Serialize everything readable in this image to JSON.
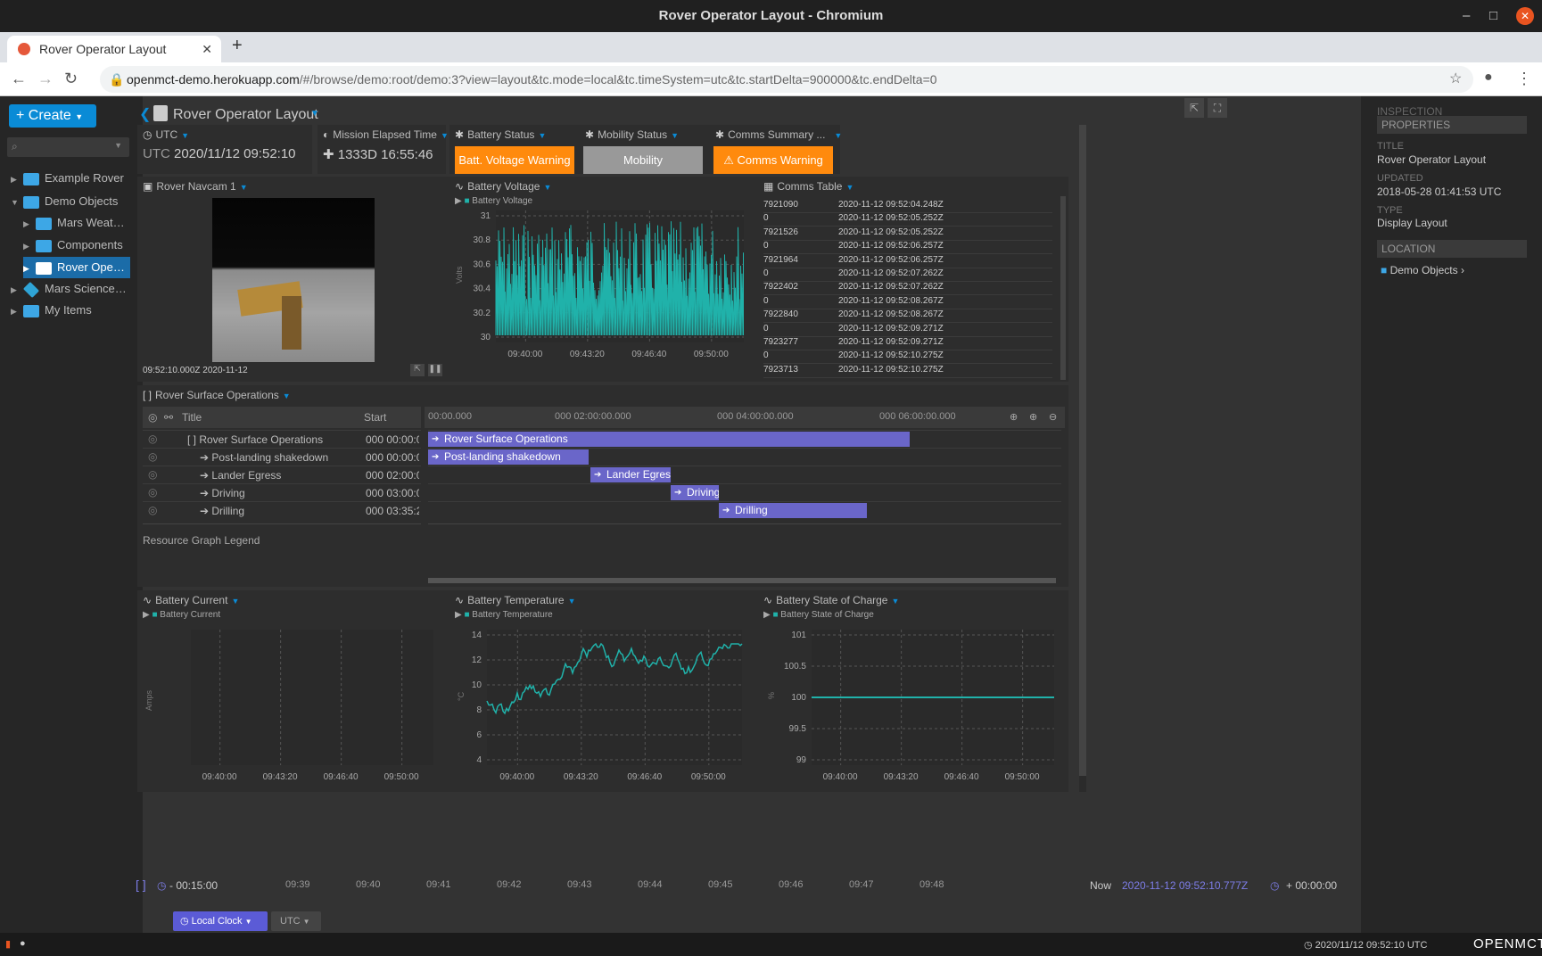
{
  "window": {
    "title": "Rover Operator Layout - Chromium"
  },
  "browser": {
    "tab_title": "Rover Operator Layout",
    "url_host": "openmct-demo.herokuapp.com",
    "url_path": "/#/browse/demo:root/demo:3?view=layout&tc.mode=local&tc.timeSystem=utc&tc.startDelta=900000&tc.endDelta=0"
  },
  "tree": {
    "create_label": "Create",
    "items": [
      "Example Rover",
      "Demo Objects",
      "Mars Weat…",
      "Components",
      "Rover Ope…",
      "Mars Science…",
      "My Items"
    ]
  },
  "header": {
    "title": "Rover Operator Layout"
  },
  "clock": {
    "title": "UTC",
    "prefix": "UTC",
    "value": "2020/11/12 09:52:10"
  },
  "met": {
    "title": "Mission Elapsed Time",
    "value": "1333D 16:55:46"
  },
  "battery_status": {
    "title": "Battery Status",
    "label": "Batt. Voltage Warning"
  },
  "mobility_status": {
    "title": "Mobility Status",
    "label": "Mobility"
  },
  "comms_summary": {
    "title": "Comms Summary ...",
    "label": "Comms Warning"
  },
  "navcam": {
    "title": "Rover Navcam 1",
    "timestamp": "09:52:10.000Z 2020-11-12"
  },
  "battery_voltage": {
    "title": "Battery Voltage",
    "legend": "Battery Voltage",
    "ylabel": "Volts",
    "yticks": [
      "31",
      "30.8",
      "30.6",
      "30.4",
      "30.2",
      "30"
    ],
    "xticks": [
      "09:40:00",
      "09:43:20",
      "09:46:40",
      "09:50:00"
    ]
  },
  "comms_table": {
    "title": "Comms Table",
    "rows": [
      [
        "7921090",
        "2020-11-12 09:52:04.248Z"
      ],
      [
        "0",
        "2020-11-12 09:52:05.252Z"
      ],
      [
        "7921526",
        "2020-11-12 09:52:05.252Z"
      ],
      [
        "0",
        "2020-11-12 09:52:06.257Z"
      ],
      [
        "7921964",
        "2020-11-12 09:52:06.257Z"
      ],
      [
        "0",
        "2020-11-12 09:52:07.262Z"
      ],
      [
        "7922402",
        "2020-11-12 09:52:07.262Z"
      ],
      [
        "0",
        "2020-11-12 09:52:08.267Z"
      ],
      [
        "7922840",
        "2020-11-12 09:52:08.267Z"
      ],
      [
        "0",
        "2020-11-12 09:52:09.271Z"
      ],
      [
        "7923277",
        "2020-11-12 09:52:09.271Z"
      ],
      [
        "0",
        "2020-11-12 09:52:10.275Z"
      ],
      [
        "7923713",
        "2020-11-12 09:52:10.275Z"
      ]
    ]
  },
  "timeline": {
    "title": "Rover Surface Operations",
    "col_title": "Title",
    "col_start": "Start",
    "ticks": [
      "00:00.000",
      "000 02:00:00.000",
      "000 04:00:00.000",
      "000 06:00:00.000"
    ],
    "rows": [
      {
        "title": "Rover Surface Operations",
        "start": "000 00:00:0"
      },
      {
        "title": "Post-landing shakedown",
        "start": "000 00:00:0"
      },
      {
        "title": "Lander Egress",
        "start": "000 02:00:0"
      },
      {
        "title": "Driving",
        "start": "000 03:00:0"
      },
      {
        "title": "Drilling",
        "start": "000 03:35:2"
      }
    ],
    "legend_label": "Resource Graph Legend"
  },
  "battery_current": {
    "title": "Battery Current",
    "legend": "Battery Current",
    "ylabel": "Amps",
    "xticks": [
      "09:40:00",
      "09:43:20",
      "09:46:40",
      "09:50:00"
    ]
  },
  "battery_temperature": {
    "title": "Battery Temperature",
    "legend": "Battery Temperature",
    "ylabel": "°C",
    "yticks": [
      "14",
      "12",
      "10",
      "8",
      "6",
      "4"
    ],
    "xticks": [
      "09:40:00",
      "09:43:20",
      "09:46:40",
      "09:50:00"
    ]
  },
  "battery_soc": {
    "title": "Battery State of Charge",
    "legend": "Battery State of Charge",
    "ylabel": "%",
    "yticks": [
      "101",
      "100.5",
      "100",
      "99.5",
      "99"
    ],
    "xticks": [
      "09:40:00",
      "09:43:20",
      "09:46:40",
      "09:50:00"
    ]
  },
  "time_conductor": {
    "start_delta": "- 00:15:00",
    "ticks": [
      "09:39",
      "09:40",
      "09:41",
      "09:42",
      "09:43",
      "09:44",
      "09:45",
      "09:46",
      "09:47",
      "09:48"
    ],
    "now_label": "Now",
    "now_value": "2020-11-12 09:52:10.777Z",
    "end_delta": "+ 00:00:00",
    "clock_mode": "Local Clock",
    "time_system": "UTC"
  },
  "inspector": {
    "heading": "INSPECTION",
    "properties": "PROPERTIES",
    "title_label": "TITLE",
    "title_value": "Rover Operator Layout",
    "updated_label": "UPDATED",
    "updated_value": "2018-05-28 01:41:53 UTC",
    "type_label": "TYPE",
    "type_value": "Display Layout",
    "location_label": "LOCATION",
    "location_value": "Demo Objects"
  },
  "status_bar": {
    "datetime": "2020/11/12 09:52:10 UTC",
    "brand": "OPENMCT"
  },
  "colors": {
    "accent": "#0a8bd6",
    "warning": "#ff8a0d",
    "plot": "#20b2aa",
    "activity": "#6a66c9"
  }
}
